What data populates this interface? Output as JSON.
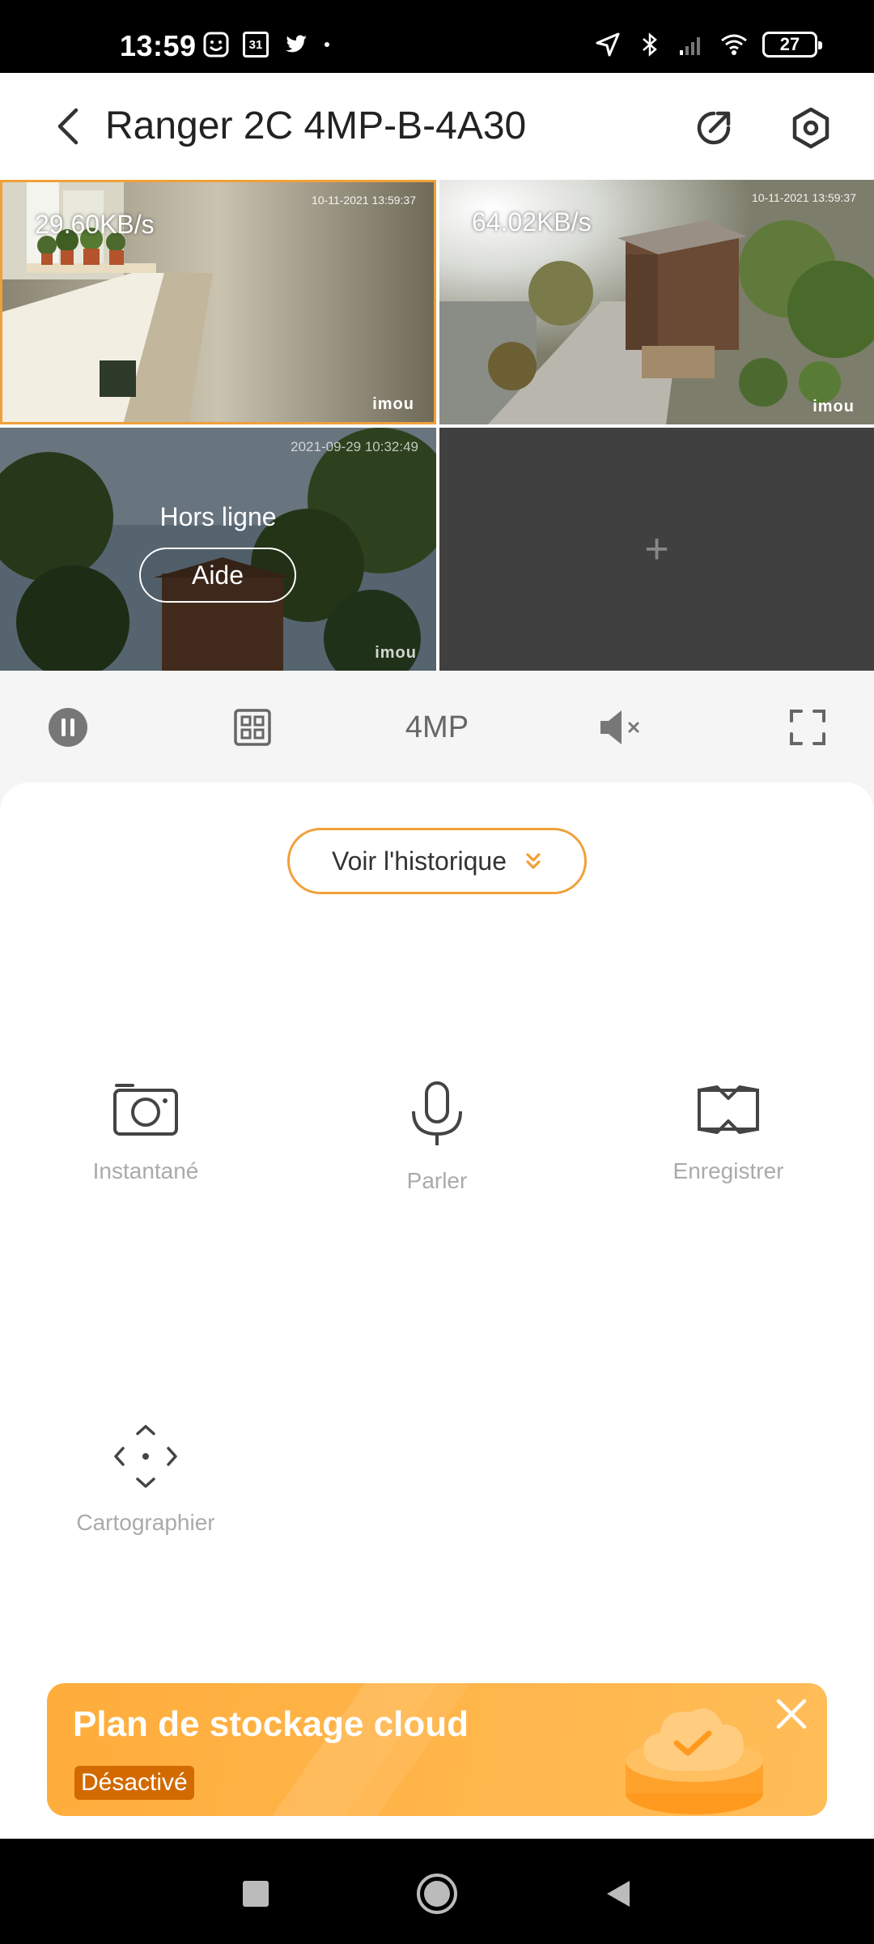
{
  "status_bar": {
    "time": "13:59",
    "calendar_day": "31",
    "battery": "27"
  },
  "header": {
    "title": "Ranger 2C 4MP-B-4A30"
  },
  "cameras": [
    {
      "speed": "29.60KB/s",
      "timestamp": "10-11-2021 13:59:37",
      "logo": "imou"
    },
    {
      "speed": "64.02KB/s",
      "timestamp": "10-11-2021 13:59:37",
      "logo": "imou"
    },
    {
      "timestamp": "2021-09-29 10:32:49",
      "logo": "imou",
      "offline_label": "Hors ligne",
      "help_label": "Aide"
    },
    {
      "add_symbol": "+"
    }
  ],
  "controls": {
    "resolution": "4MP"
  },
  "history": {
    "label": "Voir l'historique"
  },
  "actions": {
    "snapshot": "Instantané",
    "talk": "Parler",
    "record": "Enregistrer",
    "map": "Cartographier"
  },
  "banner": {
    "title": "Plan de stockage cloud",
    "status": "Désactivé"
  },
  "colors": {
    "accent": "#f0a038",
    "banner": "#ffb448",
    "offline_tile": "#404040"
  }
}
